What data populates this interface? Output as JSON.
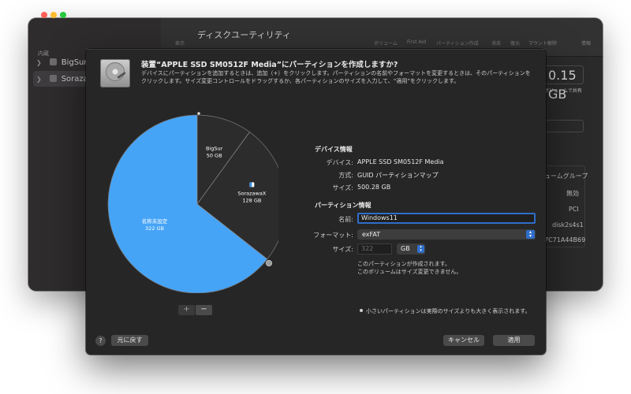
{
  "background_window": {
    "title": "ディスクユーティリティ",
    "sidebar_section": "内蔵",
    "sidebar_items": [
      {
        "label": "BigSur"
      },
      {
        "label": "Sorazawa"
      }
    ],
    "toolbar_labels": [
      "表示",
      "ボリューム",
      "First Aid",
      "パーティション作成",
      "消去",
      "復元",
      "マウント解除",
      "情報"
    ],
    "right_panel": {
      "size_text": "0.15 GB",
      "size_sub": "ボリュームで共有",
      "rows": [
        "ュームグループ",
        "無効",
        "PCI",
        "disk2s4s1",
        "7C71A44B69"
      ]
    }
  },
  "sheet": {
    "title": "装置“APPLE SSD SM0512F Media”にパーティションを作成しますか?",
    "description": "デバイスにパーティションを追加するときは、追加（+）をクリックします。パーティションの名前やフォーマットを変更するときは、そのパーティションをクリックします。サイズ変更コントロールをドラッグするか、各パーティションのサイズを入力して、“適用”をクリックします。",
    "partitions": [
      {
        "name": "名称未設定",
        "size": "322 GB",
        "value": 322,
        "color": "#46a4f7"
      },
      {
        "name": "SorazawaX",
        "size": "128 GB",
        "value": 128,
        "color": "#2c2c2c"
      },
      {
        "name": "BigSur",
        "size": "50 GB",
        "value": 50,
        "color": "#2c2c2c"
      }
    ],
    "pie_add_label": "+",
    "pie_remove_label": "−",
    "device_info": {
      "heading": "デバイス情報",
      "device_label": "デバイス:",
      "device_value": "APPLE SSD SM0512F Media",
      "scheme_label": "方式:",
      "scheme_value": "GUID パーティションマップ",
      "size_label": "サイズ:",
      "size_value": "500.28 GB"
    },
    "partition_info": {
      "heading": "パーティション情報",
      "name_label": "名前:",
      "name_value": "Windows11",
      "format_label": "フォーマット:",
      "format_value": "exFAT",
      "size_label": "サイズ:",
      "size_placeholder": "322",
      "unit_value": "GB",
      "note1": "このパーティションが作成されます。",
      "note2": "このボリュームはサイズ変更できません。"
    },
    "footnote": "小さいパーティションは実際のサイズよりも大きく表示されます。",
    "buttons": {
      "help": "?",
      "revert": "元に戻す",
      "cancel": "キャンセル",
      "apply": "適用"
    }
  }
}
